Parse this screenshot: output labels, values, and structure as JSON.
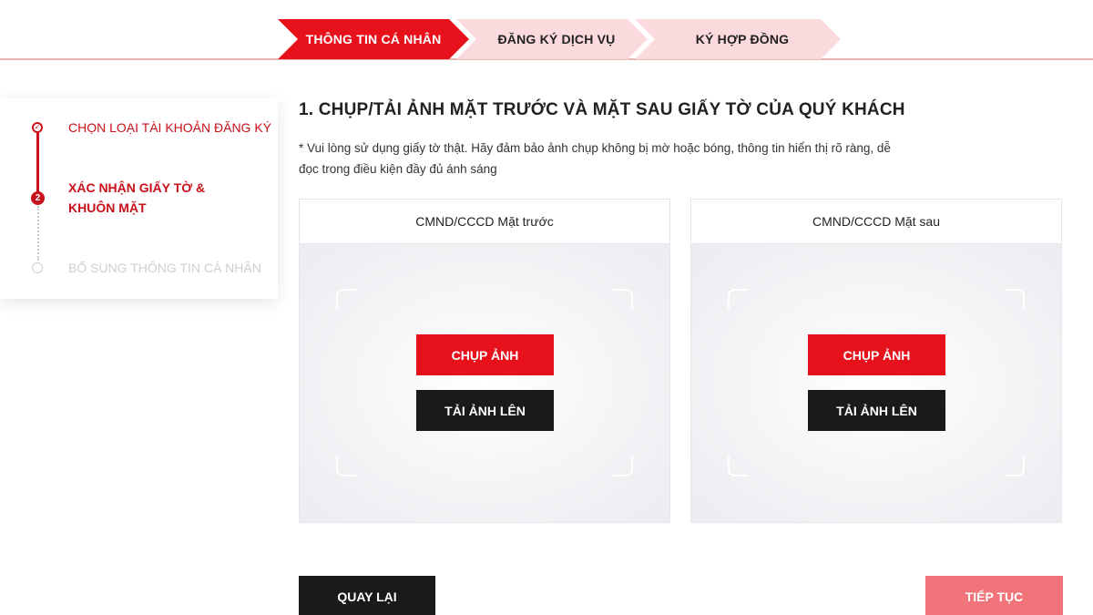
{
  "steps": [
    {
      "label": "THÔNG TIN CÁ NHÂN",
      "state": "active"
    },
    {
      "label": "ĐĂNG KÝ DỊCH VỤ",
      "state": "inactive"
    },
    {
      "label": "KÝ HỢP ĐỒNG",
      "state": "inactive"
    }
  ],
  "sidebar": {
    "items": [
      {
        "label": "CHỌN LOẠI TÀI KHOẢN ĐĂNG KÝ",
        "state": "done",
        "marker": "✓"
      },
      {
        "label": "XÁC NHẬN GIẤY TỜ & KHUÔN MẶT",
        "state": "current",
        "marker": "2"
      },
      {
        "label": "BỔ SUNG THÔNG TIN CÁ NHÂN",
        "state": "pending",
        "marker": ""
      }
    ]
  },
  "main": {
    "title": "1. CHỤP/TẢI ẢNH MẶT TRƯỚC VÀ MẶT SAU GIẤY TỜ CỦA QUÝ KHÁCH",
    "note": "* Vui lòng sử dụng giấy tờ thật. Hãy đảm bảo ảnh chụp không bị mờ hoặc bóng, thông tin hiển thị rõ ràng, dễ đọc trong điều kiện đầy đủ ánh sáng",
    "panels": [
      {
        "title": "CMND/CCCD Mặt trước",
        "capture_label": "CHỤP ẢNH",
        "upload_label": "TẢI ẢNH LÊN"
      },
      {
        "title": "CMND/CCCD Mặt sau",
        "capture_label": "CHỤP ẢNH",
        "upload_label": "TẢI ẢNH LÊN"
      }
    ]
  },
  "footer": {
    "back_label": "QUAY LẠI",
    "next_label": "TIẾP TỤC"
  },
  "colors": {
    "accent": "#e6111b",
    "step_inactive": "#fadadd",
    "dark": "#1a1a1a",
    "next_disabled": "#f1747a"
  }
}
